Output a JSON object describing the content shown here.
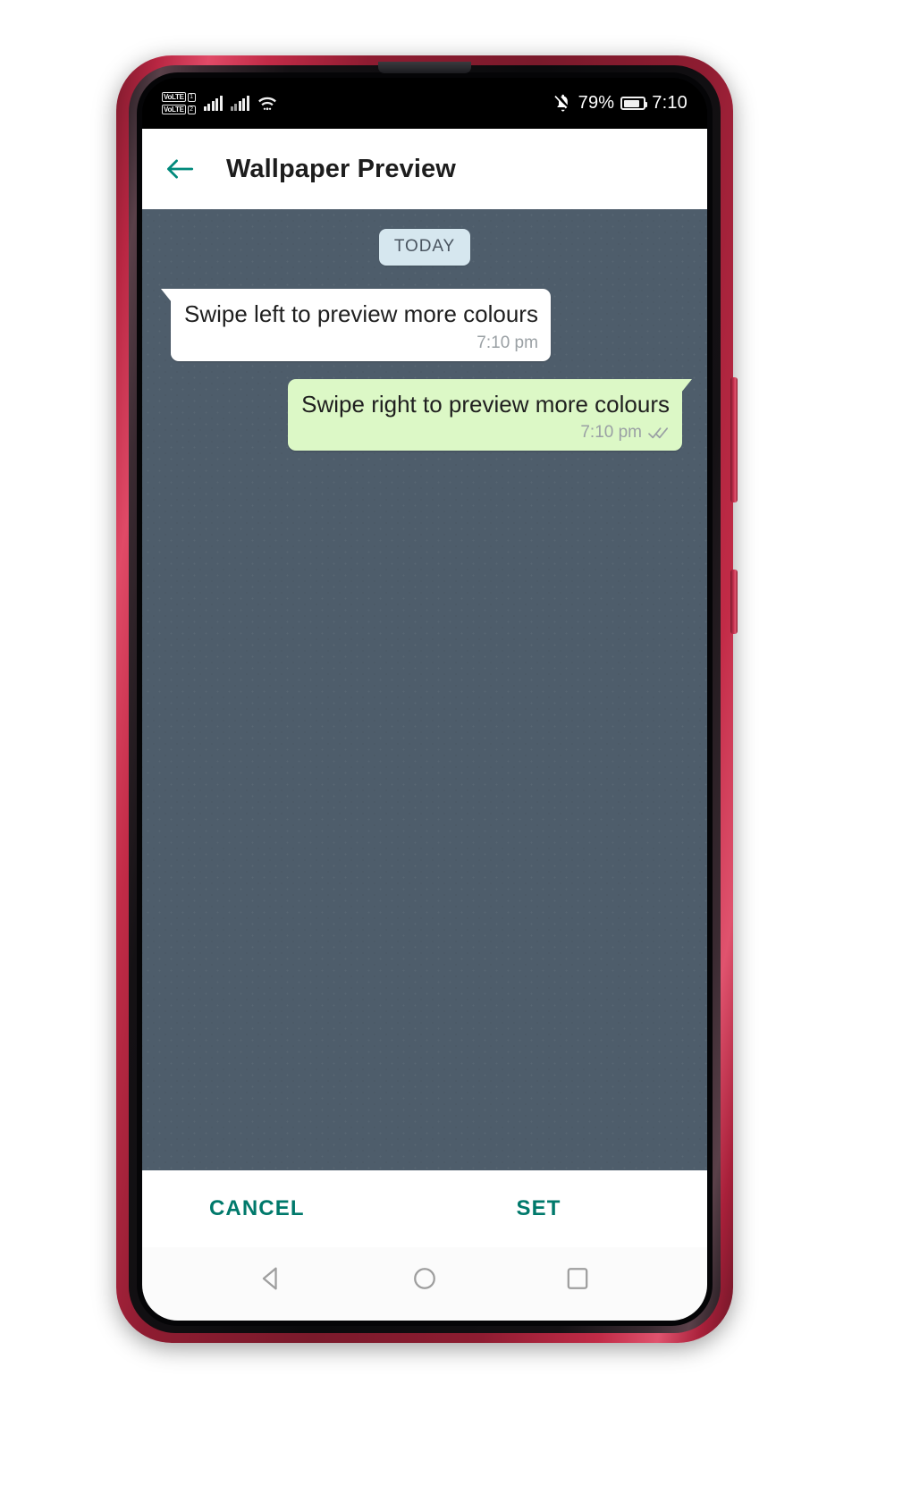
{
  "device": {
    "frame_color": "#a8203a",
    "bezel_color": "#0a0a0c"
  },
  "status_bar": {
    "volte_1_label": "VoLTE",
    "sim_1_label": "1",
    "volte_2_label": "VoLTE",
    "sim_2_label": "2",
    "signal_1_icon": "signal-bars-full-icon",
    "signal_2_icon": "signal-bars-partial-icon",
    "wifi_icon": "wifi-icon",
    "mute_icon": "bell-mute-icon",
    "battery_percent": "79%",
    "battery_icon": "battery-icon",
    "time": "7:10"
  },
  "app_bar": {
    "back_icon": "back-arrow-icon",
    "title": "Wallpaper Preview",
    "accent_color": "#00897b"
  },
  "chat": {
    "wallpaper_color": "#4e5d6b",
    "day_divider": "TODAY",
    "day_divider_bg": "#d6e7ef",
    "messages": [
      {
        "direction": "incoming",
        "text": "Swipe left to preview more colours",
        "time": "7:10 pm",
        "bubble_color": "#ffffff",
        "status_icon": ""
      },
      {
        "direction": "outgoing",
        "text": "Swipe right to preview more colours",
        "time": "7:10 pm",
        "bubble_color": "#dcf8c6",
        "status_icon": "double-check-icon"
      }
    ]
  },
  "action_bar": {
    "cancel_label": "CANCEL",
    "set_label": "SET",
    "text_color": "#00796b"
  },
  "nav_bar": {
    "back_icon": "nav-back-triangle-icon",
    "home_icon": "nav-home-circle-icon",
    "recents_icon": "nav-recents-square-icon",
    "icon_color": "#9e9e9e"
  }
}
